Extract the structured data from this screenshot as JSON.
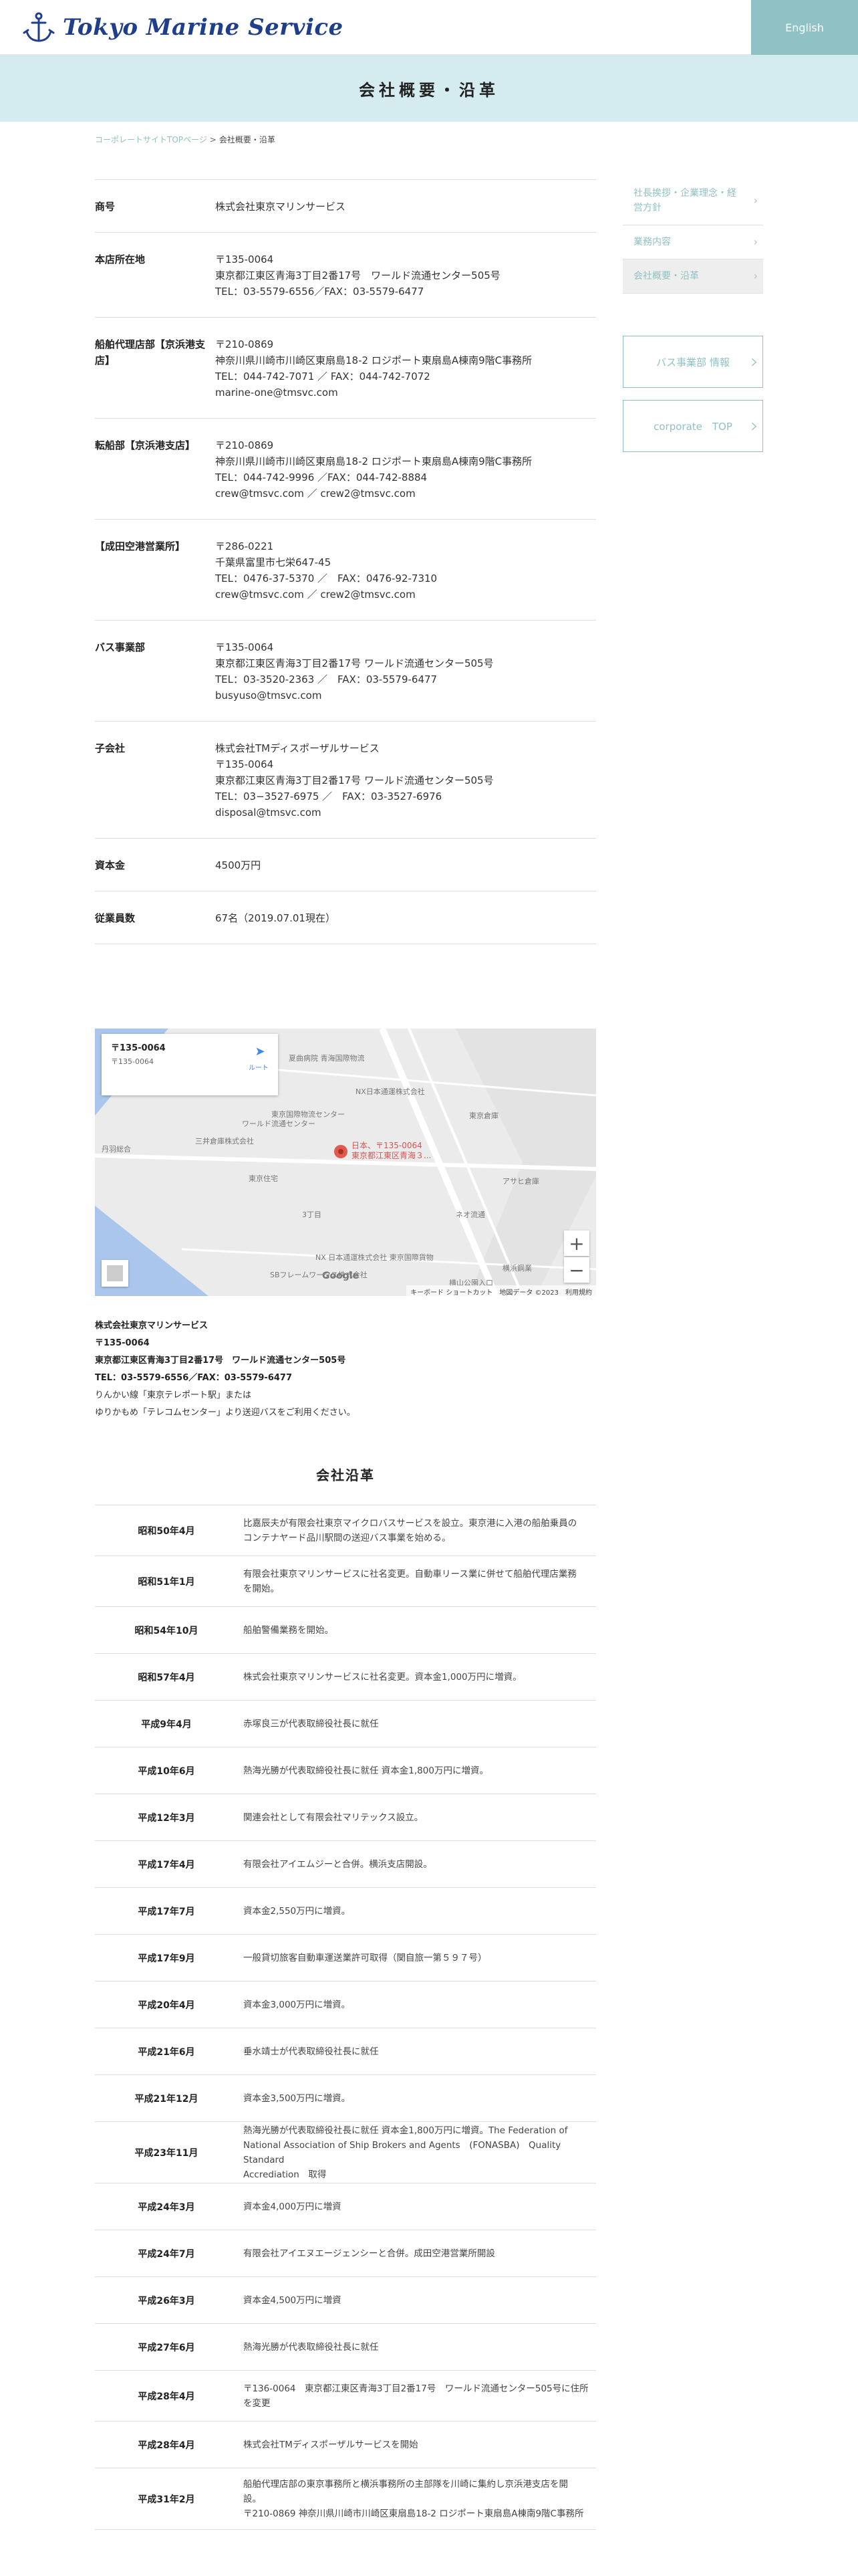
{
  "header": {
    "logo_text": "Tokyo Marine Service",
    "lang_label": "English"
  },
  "page_title": "会社概要・沿革",
  "breadcrumb": {
    "home": "コーポレートサイトTOPページ",
    "separator": ">",
    "current": "会社概要・沿革"
  },
  "profile": {
    "rows": [
      {
        "key": "商号",
        "lines": [
          "株式会社東京マリンサービス"
        ]
      },
      {
        "key": "本店所在地",
        "lines": [
          "〒135-0064",
          "東京都江東区青海3丁目2番17号　ワールド流通センター505号",
          "TEL：03-5579-6556／FAX：03-5579-6477"
        ]
      },
      {
        "key": "船舶代理店部【京浜港支店】",
        "lines": [
          "〒210-0869",
          "神奈川県川崎市川崎区東扇島18-2 ロジポート東扇島A棟南9階C事務所",
          "TEL：044-742-7071 ／ FAX：044-742-7072",
          "marine-one@tmsvc.com"
        ]
      },
      {
        "key": "転船部【京浜港支店】",
        "lines": [
          "〒210-0869",
          "神奈川県川崎市川崎区東扇島18-2 ロジポート東扇島A棟南9階C事務所",
          "TEL：044-742-9996 ／FAX：044-742-8884",
          "crew@tmsvc.com ／ crew2@tmsvc.com"
        ]
      },
      {
        "key": "【成田空港営業所】",
        "lines": [
          "〒286-0221",
          "千葉県富里市七栄647-45",
          "TEL：0476-37-5370 ／　FAX：0476-92-7310",
          "crew@tmsvc.com ／ crew2@tmsvc.com"
        ]
      },
      {
        "key": "バス事業部",
        "lines": [
          "〒135-0064",
          "東京都江東区青海3丁目2番17号 ワールド流通センター505号",
          "TEL：03-3520-2363 ／　FAX：03-5579-6477",
          "busyuso@tmsvc.com"
        ]
      },
      {
        "key": "子会社",
        "lines": [
          "株式会社TMディスポーザルサービス",
          "〒135-0064",
          "東京都江東区青海3丁目2番17号 ワールド流通センター505号",
          "TEL：03−3527-6975 ／　FAX：03-3527-6976",
          "disposal@tmsvc.com"
        ]
      },
      {
        "key": "資本金",
        "lines": [
          "4500万円"
        ]
      },
      {
        "key": "従業員数",
        "lines": [
          "67名（2019.07.01現在）"
        ]
      }
    ]
  },
  "sidebar": {
    "items": [
      {
        "label": "社長挨拶・企業理念・経営方針",
        "active": false
      },
      {
        "label": "業務内容",
        "active": false
      },
      {
        "label": "会社概要・沿革",
        "active": true
      }
    ],
    "chevron": "›",
    "bus_button": "バス事業部 情報",
    "corporate_button": "corporate　TOP"
  },
  "map": {
    "card_title": "〒135-0064 ",
    "card_subtitle": "〒135-0064 ",
    "card_link": "",
    "directions_label": "ルート",
    "pin_label_1": "日本、〒135-0064",
    "pin_label_2": "東京都江東区青海３...",
    "labels": [
      "夏曲病院 青海国際物流",
      "NX日本通運株式会社",
      "ワールド流通センター",
      "東京国際物流センター",
      "三井倉庫株式会社",
      "東京倉庫",
      "東京住宅",
      "アサヒ倉庫",
      "丹羽総合",
      "3丁目",
      "NX 日本通運株式会社 東京国際貨物",
      "SBフレームワークス株式会社",
      "ネオ流通",
      "横浜鋼業",
      "横山公園入口"
    ],
    "zoom_in": "+",
    "zoom_out": "−",
    "google": "Google",
    "footer": "キーボード ショートカット　地図データ ©2023　利用規約"
  },
  "address": {
    "company": "株式会社東京マリンサービス",
    "zip": "〒135-0064",
    "street": "東京都江東区青海3丁目2番17号　ワールド流通センター505号",
    "tel": "TEL：03-5579-6556／FAX：03-5579-6477",
    "access1": "りんかい線「東京テレポート駅」または",
    "access2": "ゆりかもめ「テレコムセンター」より送迎バスをご利用ください。"
  },
  "history": {
    "title": "会社沿革",
    "rows": [
      {
        "date": "昭和50年4月",
        "text": [
          "比嘉辰夫が有限会社東京マイクロバスサービスを設立。東京港に入港の船舶乗員の",
          "コンテナヤード品川駅間の送迎バス事業を始める。"
        ]
      },
      {
        "date": "昭和51年1月",
        "text": [
          "有限会社東京マリンサービスに社名変更。自動車リース業に併せて船舶代理店業務",
          "を開始。"
        ]
      },
      {
        "date": "昭和54年10月",
        "text": [
          "船舶警備業務を開始。"
        ]
      },
      {
        "date": "昭和57年4月",
        "text": [
          "株式会社東京マリンサービスに社名変更。資本金1,000万円に増資。"
        ]
      },
      {
        "date": "平成9年4月",
        "text": [
          "赤塚良三が代表取締役社長に就任"
        ]
      },
      {
        "date": "平成10年6月",
        "text": [
          "熱海光勝が代表取締役社長に就任 資本金1,800万円に増資。"
        ]
      },
      {
        "date": "平成12年3月",
        "text": [
          "関連会社として有限会社マリテックス設立。"
        ]
      },
      {
        "date": "平成17年4月",
        "text": [
          "有限会社アイエムジーと合併。横浜支店開設。"
        ]
      },
      {
        "date": "平成17年7月",
        "text": [
          "資本金2,550万円に増資。"
        ]
      },
      {
        "date": "平成17年9月",
        "text": [
          "一般貸切旅客自動車運送業許可取得（関自旅一第５９７号）"
        ]
      },
      {
        "date": "平成20年4月",
        "text": [
          "資本金3,000万円に増資。"
        ]
      },
      {
        "date": "平成21年6月",
        "text": [
          "垂水靖士が代表取締役社長に就任"
        ]
      },
      {
        "date": "平成21年12月",
        "text": [
          "資本金3,500万円に増資。"
        ]
      },
      {
        "date": "平成23年11月",
        "text": [
          "熱海光勝が代表取締役社長に就任 資本金1,800万円に増資。The Federation of",
          "National Association of Ship Brokers and Agents　(FONASBA)　Quality Standard",
          "Accrediation　取得"
        ]
      },
      {
        "date": "平成24年3月",
        "text": [
          "資本金4,000万円に増資"
        ]
      },
      {
        "date": "平成24年7月",
        "text": [
          "有限会社アイエヌエージェンシーと合併。成田空港営業所開設"
        ]
      },
      {
        "date": "平成26年3月",
        "text": [
          "資本金4,500万円に増資"
        ]
      },
      {
        "date": "平成27年6月",
        "text": [
          "熱海光勝が代表取締役社長に就任"
        ]
      },
      {
        "date": "平成28年4月",
        "text": [
          "〒136-0064　東京都江東区青海3丁目2番17号　ワールド流通センター505号に住所",
          "を変更"
        ]
      },
      {
        "date": "平成28年4月",
        "text": [
          "株式会社TMディスポーザルサービスを開始"
        ]
      },
      {
        "date": "平成31年2月",
        "text": [
          "船舶代理店部の東京事務所と横浜事務所の主部隊を川崎に集約し京浜港支店を開",
          "設。",
          "〒210-0869 神奈川県川崎市川崎区東扇島18-2 ロジポート東扇島A棟南9階C事務所"
        ]
      }
    ]
  },
  "colors": {
    "accent": "#8fc1c5",
    "band": "#d4ecef",
    "logo": "#1f3f8a"
  }
}
